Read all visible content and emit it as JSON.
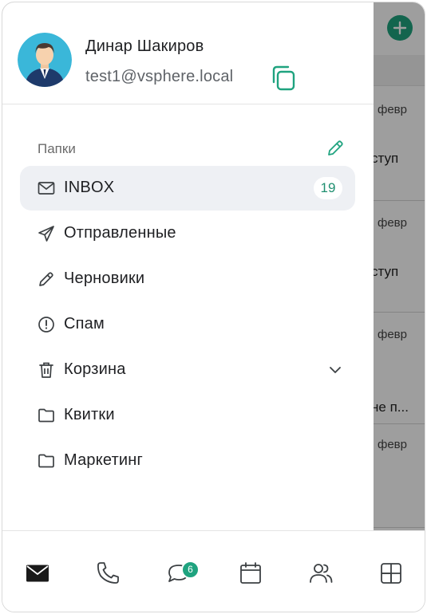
{
  "profile": {
    "name": "Динар Шакиров",
    "email": "test1@vsphere.local"
  },
  "folders_section": {
    "label": "Папки"
  },
  "folders": [
    {
      "label": "INBOX",
      "icon": "mail-icon",
      "count": "19",
      "active": true
    },
    {
      "label": "Отправленные",
      "icon": "send-icon"
    },
    {
      "label": "Черновики",
      "icon": "pencil-icon"
    },
    {
      "label": "Спам",
      "icon": "alert-circle-icon"
    },
    {
      "label": "Корзина",
      "icon": "trash-icon",
      "expandable": true
    },
    {
      "label": "Квитки",
      "icon": "folder-icon"
    },
    {
      "label": "Маркетинг",
      "icon": "folder-icon"
    }
  ],
  "background_list": {
    "rows": [
      {
        "date": "февр",
        "snippet": "ступ"
      },
      {
        "date": "февр",
        "snippet": "ступ"
      },
      {
        "date": "февр",
        "snippet": "не п..."
      },
      {
        "date": "февр",
        "snippet": ""
      }
    ]
  },
  "bottom_nav": {
    "tabs": [
      "mail-icon",
      "phone-icon",
      "chat-icon",
      "calendar-icon",
      "contacts-icon",
      "apps-icon"
    ],
    "chat_badge": "6"
  },
  "colors": {
    "accent": "#1fa37f",
    "badge_text": "#1f8f70",
    "active_item_bg": "#eef0f4"
  }
}
